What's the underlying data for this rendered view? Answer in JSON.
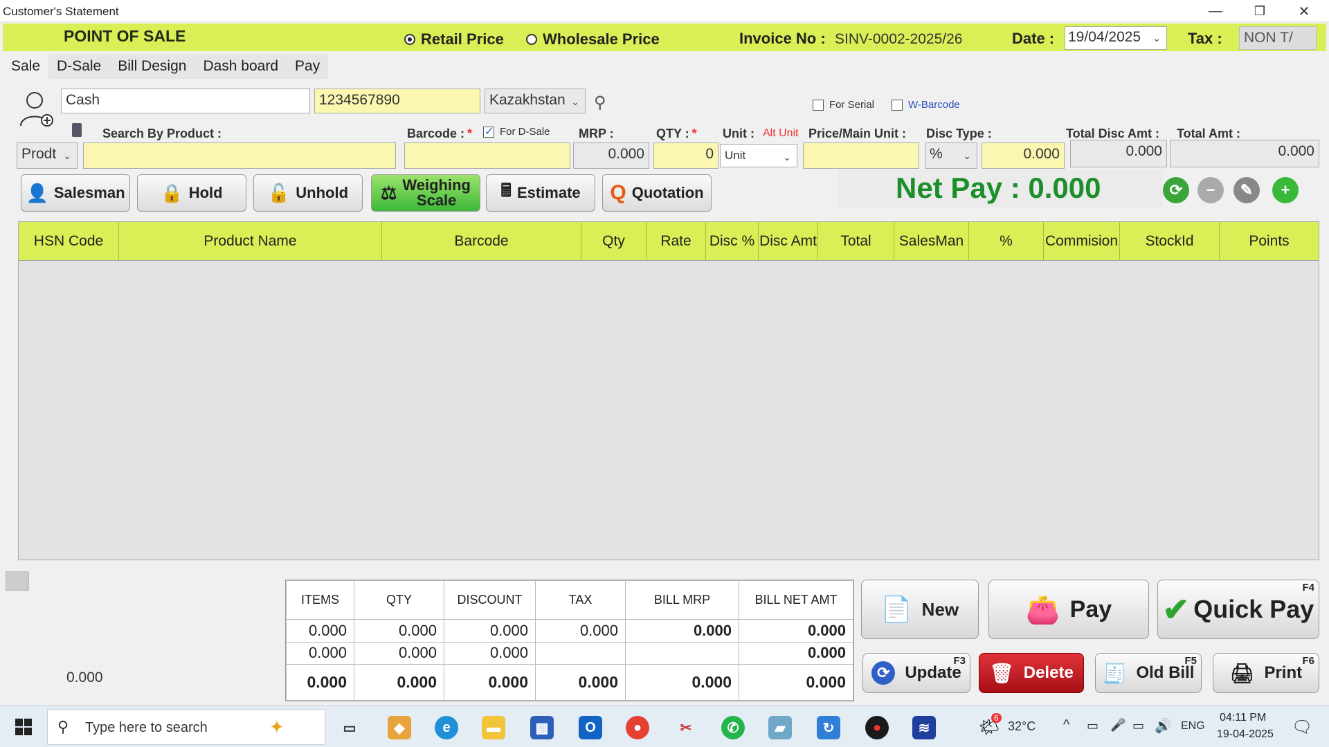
{
  "window": {
    "title": "Customer's Statement",
    "minimize": "—",
    "restore": "❐",
    "close": "✕"
  },
  "header": {
    "app_title": "POINT OF SALE",
    "retail_price": "Retail Price",
    "wholesale_price": "Wholesale Price",
    "selected_price": "Retail Price",
    "invoice_label": "Invoice No :",
    "invoice_no": "SINV-0002-2025/26",
    "date_label": "Date :",
    "date": "19/04/2025",
    "tax_label": "Tax :",
    "tax_value": "NON T/"
  },
  "tabs": [
    "Sale",
    "D-Sale",
    "Bill Design",
    "Dash board",
    "Pay"
  ],
  "customer": {
    "name": "Cash",
    "phone": "1234567890",
    "country": "Kazakhstan"
  },
  "options": {
    "for_serial": "For Serial",
    "w_barcode": "W-Barcode",
    "for_dsale": "For D-Sale"
  },
  "entry": {
    "search_label": "Search By Product :",
    "search_mode": "Prodt",
    "barcode_label": "Barcode :",
    "mrp_label": "MRP :",
    "mrp": "0.000",
    "qty_label": "QTY :",
    "qty": "0",
    "unit_label": "Unit :",
    "alt_unit": "Alt Unit",
    "unit": "Unit",
    "price_label": "Price/Main Unit :",
    "disc_type_label": "Disc Type :",
    "disc_type": "%",
    "disc_value": "0.000",
    "total_disc_label": "Total Disc Amt :",
    "total_disc": "0.000",
    "total_amt_label": "Total Amt :",
    "total_amt": "0.000"
  },
  "actions": {
    "salesman": "Salesman",
    "hold": "Hold",
    "unhold": "Unhold",
    "weighing_scale_1": "Weighing",
    "weighing_scale_2": "Scale",
    "estimate": "Estimate",
    "quotation": "Quotation"
  },
  "net_pay": "Net Pay : 0.000",
  "grid_columns": [
    "HSN Code",
    "Product Name",
    "Barcode",
    "Qty",
    "Rate",
    "Disc %",
    "Disc Amt",
    "Total",
    "SalesMan",
    "%",
    "Commision",
    "StockId",
    "Points"
  ],
  "left_total": "0.000",
  "summary": {
    "headers": [
      "ITEMS",
      "QTY",
      "DISCOUNT",
      "TAX",
      "BILL MRP",
      "BILL NET AMT"
    ],
    "row1": [
      "0.000",
      "0.000",
      "0.000",
      "0.000",
      "0.000",
      "0.000"
    ],
    "row2": [
      "0.000",
      "0.000",
      "0.000",
      "",
      "",
      "0.000"
    ],
    "row3": [
      "0.000",
      "0.000",
      "0.000",
      "0.000",
      "0.000",
      "0.000"
    ]
  },
  "bottom_buttons": {
    "new": "New",
    "pay": "Pay",
    "quick_pay": "Quick Pay",
    "quick_pay_key": "F4",
    "update": "Update",
    "update_key": "F3",
    "delete": "Delete",
    "old_bill": "Old Bill",
    "old_bill_key": "F5",
    "print": "Print",
    "print_key": "F6"
  },
  "taskbar": {
    "search_placeholder": "Type here to search",
    "weather": "32°C",
    "weather_badge": "6",
    "language": "ENG",
    "time": "04:11 PM",
    "date": "19-04-2025"
  },
  "colors": {
    "accent_green": "#d9ef55",
    "net_pay": "#1b8f2a",
    "delete_red": "#c8151e"
  }
}
